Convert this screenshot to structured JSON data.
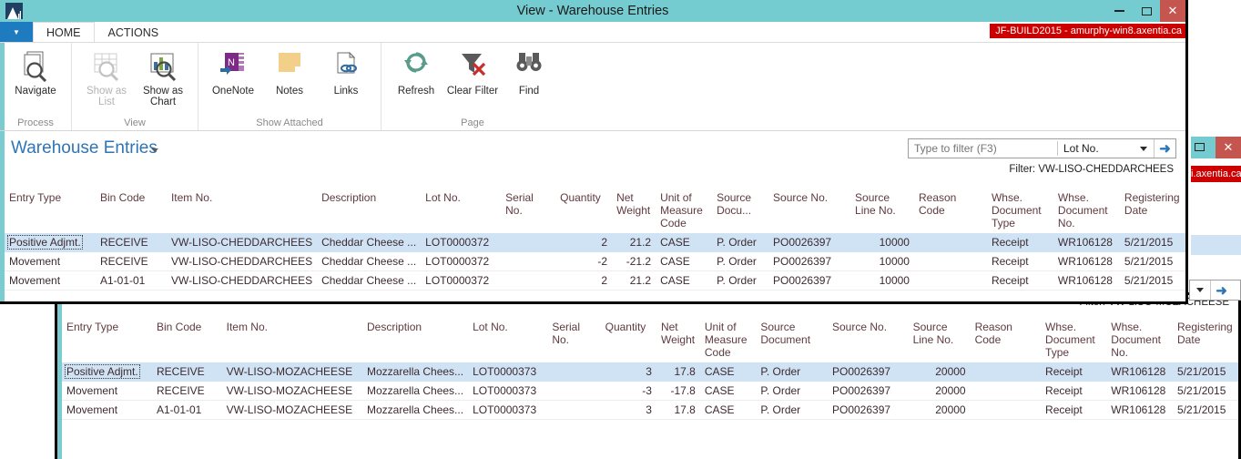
{
  "window_front": {
    "title": "View - Warehouse Entries",
    "logo_name": "dynamics-nav-logo",
    "controls": {
      "minimize": "–",
      "maximize": "□",
      "close": "✕"
    },
    "app_menu_caret": "▼",
    "tabs": [
      {
        "label": "HOME",
        "active": true
      },
      {
        "label": "ACTIONS",
        "active": false
      }
    ],
    "env_badge": "JF-BUILD2015 - amurphy-win8.axentia.ca",
    "ribbon": {
      "groups": [
        {
          "label": "Process",
          "buttons": [
            {
              "label": "Navigate",
              "icon": "navigate-magnifier-icon",
              "disabled": false
            }
          ]
        },
        {
          "label": "View",
          "buttons": [
            {
              "label": "Show as List",
              "icon": "show-as-list-icon",
              "disabled": true
            },
            {
              "label": "Show as Chart",
              "icon": "show-as-chart-icon",
              "disabled": false
            }
          ]
        },
        {
          "label": "Show Attached",
          "buttons": [
            {
              "label": "OneNote",
              "icon": "onenote-icon",
              "disabled": false
            },
            {
              "label": "Notes",
              "icon": "notes-icon",
              "disabled": false
            },
            {
              "label": "Links",
              "icon": "links-icon",
              "disabled": false
            }
          ]
        },
        {
          "label": "Page",
          "buttons": [
            {
              "label": "Refresh",
              "icon": "refresh-icon",
              "disabled": false
            },
            {
              "label": "Clear Filter",
              "icon": "clear-filter-icon",
              "disabled": false
            },
            {
              "label": "Find",
              "icon": "find-binoculars-icon",
              "disabled": false
            }
          ]
        }
      ]
    },
    "page_title": "Warehouse Entries",
    "search": {
      "placeholder": "Type to filter (F3)",
      "value": "",
      "field": "Lot No.",
      "go_glyph": "➜"
    },
    "filter_label": "Filter: VW-LISO-CHEDDARCHEES"
  },
  "window_back": {
    "filter_label": "Filter: VW-LISO-MOZACHEESE",
    "controls": {
      "maximize": "□",
      "close": "✕"
    },
    "env_badge_fragment": "i.axentia.ca",
    "mini_filter": {
      "caret": "▼",
      "go_glyph": "➜"
    }
  },
  "columns": [
    {
      "key": "entry_type",
      "label": "Entry Type",
      "width": 100,
      "align": "left"
    },
    {
      "key": "bin_code",
      "label": "Bin Code",
      "width": 78,
      "align": "left"
    },
    {
      "key": "item_no",
      "label": "Item No.",
      "width": 155,
      "align": "left"
    },
    {
      "key": "description",
      "label": "Description",
      "width": 110,
      "align": "left"
    },
    {
      "key": "lot_no",
      "label": "Lot No.",
      "width": 88,
      "align": "left"
    },
    {
      "key": "serial_no",
      "label": "Serial No.",
      "width": 60,
      "align": "left"
    },
    {
      "key": "quantity",
      "label": "Quantity",
      "width": 62,
      "align": "right"
    },
    {
      "key": "net_weight",
      "label": "Net Weight",
      "width": 48,
      "align": "right"
    },
    {
      "key": "uom_code",
      "label": "Unit of Measure Code",
      "width": 62,
      "align": "left"
    },
    {
      "key": "source_doc",
      "label": "Source Docu...",
      "width": 62,
      "align": "left"
    },
    {
      "key": "source_no",
      "label": "Source No.",
      "width": 90,
      "align": "left"
    },
    {
      "key": "src_line_no",
      "label": "Source Line No.",
      "width": 70,
      "align": "right"
    },
    {
      "key": "reason_code",
      "label": "Reason Code",
      "width": 80,
      "align": "left"
    },
    {
      "key": "whse_doc_type",
      "label": "Whse. Document Type",
      "width": 73,
      "align": "left"
    },
    {
      "key": "whse_doc_no",
      "label": "Whse. Document No.",
      "width": 73,
      "align": "left"
    },
    {
      "key": "reg_date",
      "label": "Registering Date",
      "width": 72,
      "align": "left"
    }
  ],
  "columns_back": [
    {
      "key": "entry_type",
      "label": "Entry Type",
      "width": 100,
      "align": "left"
    },
    {
      "key": "bin_code",
      "label": "Bin Code",
      "width": 78,
      "align": "left"
    },
    {
      "key": "item_no",
      "label": "Item No.",
      "width": 155,
      "align": "left"
    },
    {
      "key": "description",
      "label": "Description",
      "width": 110,
      "align": "left"
    },
    {
      "key": "lot_no",
      "label": "Lot No.",
      "width": 88,
      "align": "left"
    },
    {
      "key": "serial_no",
      "label": "Serial No.",
      "width": 60,
      "align": "left"
    },
    {
      "key": "quantity",
      "label": "Quantity",
      "width": 62,
      "align": "right"
    },
    {
      "key": "net_weight",
      "label": "Net Weight",
      "width": 48,
      "align": "right"
    },
    {
      "key": "uom_code",
      "label": "Unit of Measure Code",
      "width": 62,
      "align": "left"
    },
    {
      "key": "source_doc",
      "label": "Source Document",
      "width": 80,
      "align": "left"
    },
    {
      "key": "source_no",
      "label": "Source No.",
      "width": 90,
      "align": "left"
    },
    {
      "key": "src_line_no",
      "label": "Source Line No.",
      "width": 70,
      "align": "right"
    },
    {
      "key": "reason_code",
      "label": "Reason Code",
      "width": 80,
      "align": "left"
    },
    {
      "key": "whse_doc_type",
      "label": "Whse. Document Type",
      "width": 73,
      "align": "left"
    },
    {
      "key": "whse_doc_no",
      "label": "Whse. Document No.",
      "width": 73,
      "align": "left"
    },
    {
      "key": "reg_date",
      "label": "Registering Date",
      "width": 72,
      "align": "left"
    }
  ],
  "rows_front": [
    {
      "selected": true,
      "entry_type": "Positive Adjmt.",
      "bin_code": "RECEIVE",
      "item_no": "VW-LISO-CHEDDARCHEES",
      "description": "Cheddar Cheese ...",
      "lot_no": "LOT0000372",
      "serial_no": "",
      "quantity": "2",
      "net_weight": "21.2",
      "uom_code": "CASE",
      "source_doc": "P. Order",
      "source_no": "PO0026397",
      "src_line_no": "10000",
      "reason_code": "",
      "whse_doc_type": "Receipt",
      "whse_doc_no": "WR106128",
      "reg_date": "5/21/2015"
    },
    {
      "selected": false,
      "entry_type": "Movement",
      "bin_code": "RECEIVE",
      "item_no": "VW-LISO-CHEDDARCHEES",
      "description": "Cheddar Cheese ...",
      "lot_no": "LOT0000372",
      "serial_no": "",
      "quantity": "-2",
      "net_weight": "-21.2",
      "uom_code": "CASE",
      "source_doc": "P. Order",
      "source_no": "PO0026397",
      "src_line_no": "10000",
      "reason_code": "",
      "whse_doc_type": "Receipt",
      "whse_doc_no": "WR106128",
      "reg_date": "5/21/2015"
    },
    {
      "selected": false,
      "entry_type": "Movement",
      "bin_code": "A1-01-01",
      "item_no": "VW-LISO-CHEDDARCHEES",
      "description": "Cheddar Cheese ...",
      "lot_no": "LOT0000372",
      "serial_no": "",
      "quantity": "2",
      "net_weight": "21.2",
      "uom_code": "CASE",
      "source_doc": "P. Order",
      "source_no": "PO0026397",
      "src_line_no": "10000",
      "reason_code": "",
      "whse_doc_type": "Receipt",
      "whse_doc_no": "WR106128",
      "reg_date": "5/21/2015"
    }
  ],
  "rows_back": [
    {
      "selected": true,
      "entry_type": "Positive Adjmt.",
      "bin_code": "RECEIVE",
      "item_no": "VW-LISO-MOZACHEESE",
      "description": "Mozzarella Chees...",
      "lot_no": "LOT0000373",
      "serial_no": "",
      "quantity": "3",
      "net_weight": "17.8",
      "uom_code": "CASE",
      "source_doc": "P. Order",
      "source_no": "PO0026397",
      "src_line_no": "20000",
      "reason_code": "",
      "whse_doc_type": "Receipt",
      "whse_doc_no": "WR106128",
      "reg_date": "5/21/2015"
    },
    {
      "selected": false,
      "entry_type": "Movement",
      "bin_code": "RECEIVE",
      "item_no": "VW-LISO-MOZACHEESE",
      "description": "Mozzarella Chees...",
      "lot_no": "LOT0000373",
      "serial_no": "",
      "quantity": "-3",
      "net_weight": "-17.8",
      "uom_code": "CASE",
      "source_doc": "P. Order",
      "source_no": "PO0026397",
      "src_line_no": "20000",
      "reason_code": "",
      "whse_doc_type": "Receipt",
      "whse_doc_no": "WR106128",
      "reg_date": "5/21/2015"
    },
    {
      "selected": false,
      "entry_type": "Movement",
      "bin_code": "A1-01-01",
      "item_no": "VW-LISO-MOZACHEESE",
      "description": "Mozzarella Chees...",
      "lot_no": "LOT0000373",
      "serial_no": "",
      "quantity": "3",
      "net_weight": "17.8",
      "uom_code": "CASE",
      "source_doc": "P. Order",
      "source_no": "PO0026397",
      "src_line_no": "20000",
      "reason_code": "",
      "whse_doc_type": "Receipt",
      "whse_doc_no": "WR106128",
      "reg_date": "5/21/2015"
    }
  ],
  "colors": {
    "titlebar": "#74cbd0",
    "accent_bar": "#7accd0",
    "env_badge": "#cc0000",
    "selection": "#cfe3f5",
    "title_link": "#2e75b6",
    "close_button": "#c5554f"
  }
}
